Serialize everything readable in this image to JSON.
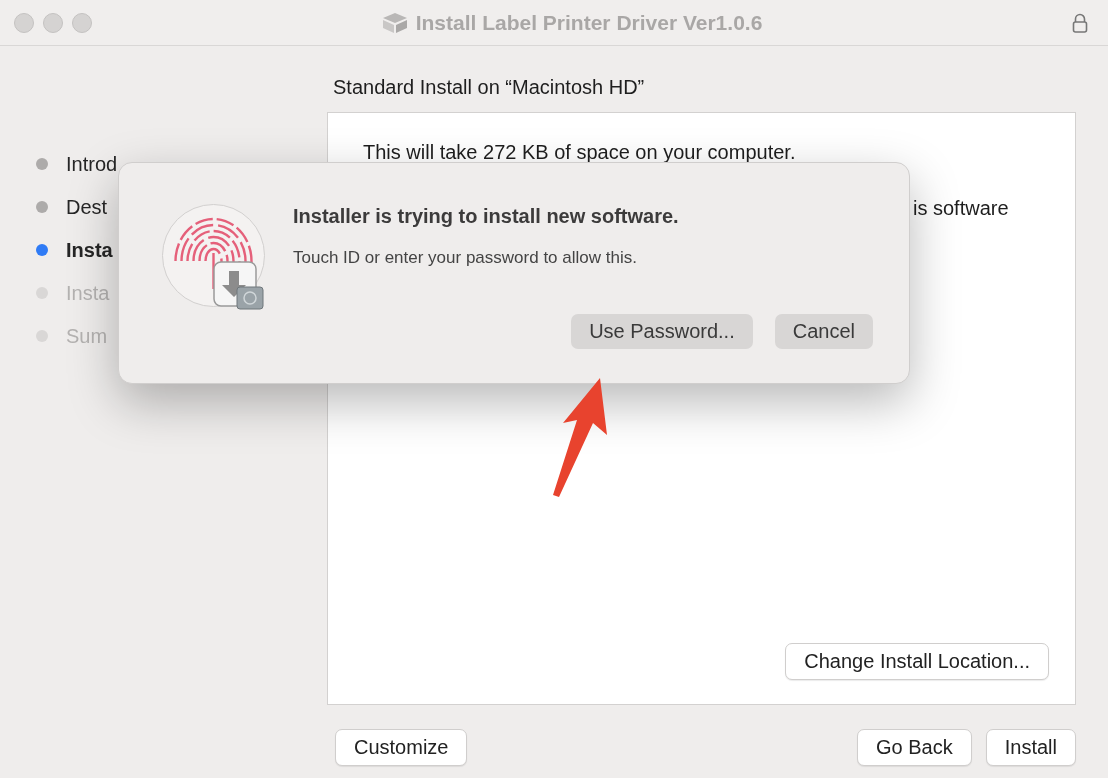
{
  "window": {
    "title": "Install Label Printer Driver Ver1.0.6"
  },
  "sidebar": {
    "items": [
      {
        "label": "Introd",
        "dimmed": false,
        "selected": false
      },
      {
        "label": "Dest",
        "dimmed": false,
        "selected": false
      },
      {
        "label": "Insta",
        "dimmed": false,
        "selected": true
      },
      {
        "label": "Insta",
        "dimmed": true,
        "selected": false
      },
      {
        "label": "Sum",
        "dimmed": true,
        "selected": false
      }
    ]
  },
  "main": {
    "heading": "Standard Install on “Macintosh HD”",
    "lines": [
      "This will take 272 KB of space on your computer.",
      "is software"
    ],
    "change_location_button": "Change Install Location...",
    "left_buttons": [
      "Customize"
    ],
    "right_buttons": [
      "Go Back",
      "Install"
    ]
  },
  "dialog": {
    "title": "Installer is trying to install new software.",
    "message": "Touch ID or enter your password to allow this.",
    "buttons": [
      {
        "label": "Use Password..."
      },
      {
        "label": "Cancel"
      }
    ]
  }
}
